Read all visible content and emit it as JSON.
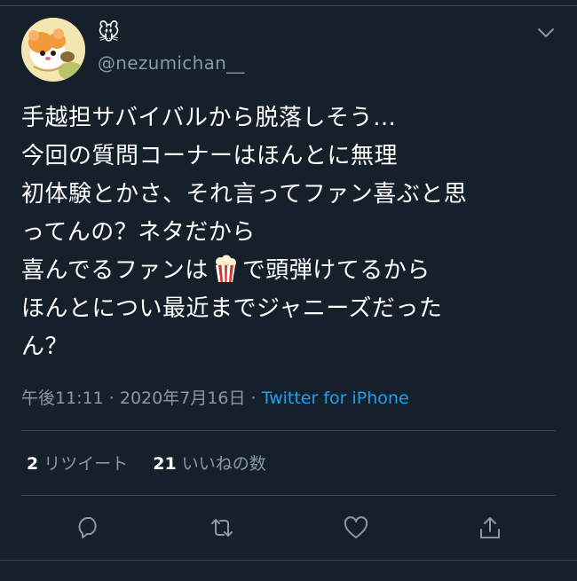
{
  "tweet": {
    "display_name": "🐭",
    "handle": "@nezumichan__",
    "lines": [
      "手越担サバイバルから脱落しそう…",
      "今回の質問コーナーはほんとに無理",
      "初体験とかさ、それ言ってファン喜ぶと思",
      "ってんの？ネタだから"
    ],
    "line5_before": "喜んでるファンは",
    "line5_emoji": "popcorn-emoji",
    "line5_after": "で頭弾けてるから",
    "line6": "ほんとについ最近までジャニーズだった",
    "line7": "ん？",
    "timestamp": "午後11:11 · 2020年7月16日 ·",
    "source": "Twitter for iPhone",
    "retweets": {
      "count": "2",
      "label": "リツイート"
    },
    "likes": {
      "count": "21",
      "label": "いいねの数"
    }
  },
  "icons": {
    "menu": "chevron-down-icon",
    "reply": "reply-icon",
    "retweet": "retweet-icon",
    "like": "heart-icon",
    "share": "share-icon"
  },
  "colors": {
    "background": "#15202b",
    "text": "#ffffff",
    "secondary": "#8899a6",
    "link": "#1da1f2",
    "divider": "#38444d"
  }
}
